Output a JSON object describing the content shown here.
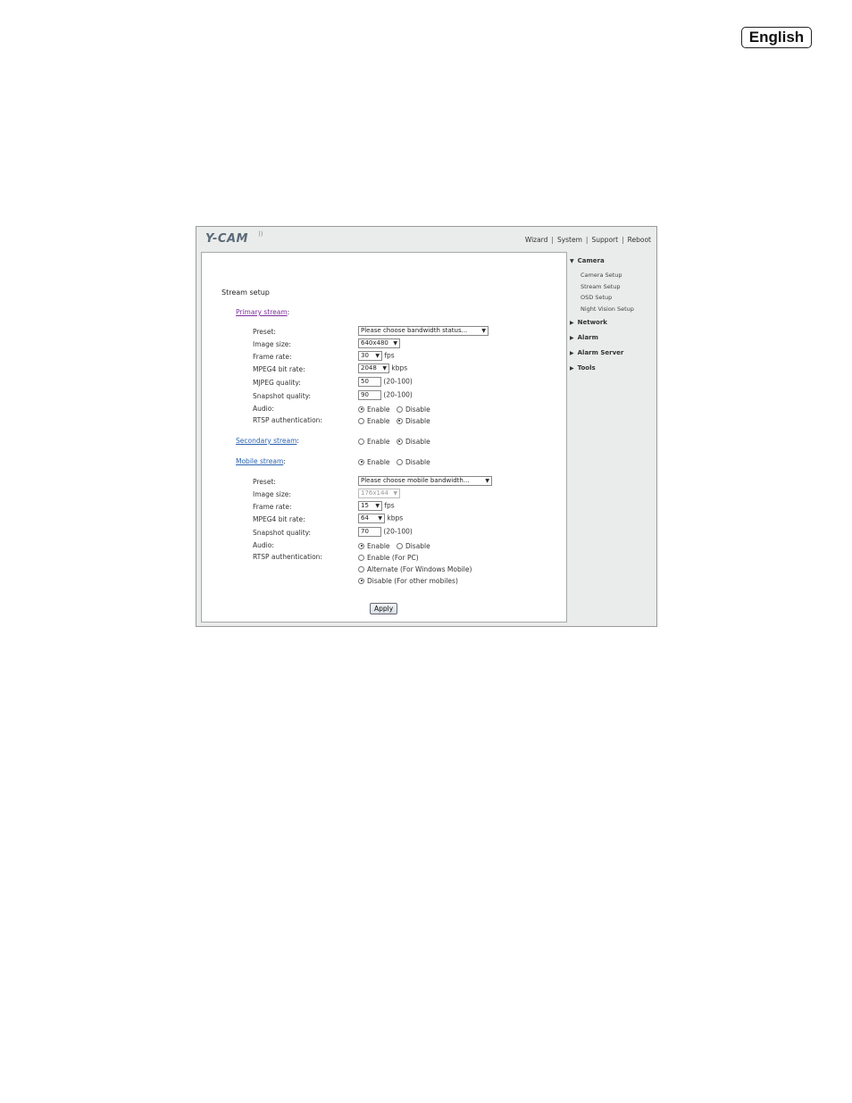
{
  "language_badge": "English",
  "header": {
    "logo": "Y-CAM",
    "logo_mark": "))",
    "links": [
      "Wizard",
      "System",
      "Support",
      "Reboot"
    ],
    "separator": "|"
  },
  "sidebar": {
    "sections": [
      {
        "label": "Camera",
        "expanded": true,
        "items": [
          "Camera Setup",
          "Stream Setup",
          "OSD Setup",
          "Night Vision Setup"
        ]
      },
      {
        "label": "Network",
        "expanded": false
      },
      {
        "label": "Alarm",
        "expanded": false
      },
      {
        "label": "Alarm Server",
        "expanded": false
      },
      {
        "label": "Tools",
        "expanded": false
      }
    ]
  },
  "form": {
    "title": "Stream setup",
    "colon": ":",
    "primary": {
      "link": "Primary stream",
      "link_color": "#7b2f9a",
      "preset_label": "Preset:",
      "preset_value": "Please choose bandwidth status...",
      "image_size_label": "Image size:",
      "image_size_value": "640x480",
      "frame_rate_label": "Frame rate:",
      "frame_rate_value": "30",
      "frame_rate_unit": "fps",
      "mpeg4_label": "MPEG4 bit rate:",
      "mpeg4_value": "2048",
      "mpeg4_unit": "kbps",
      "mjpeg_label": "MJPEG quality:",
      "mjpeg_value": "50",
      "mjpeg_range": "(20-100)",
      "snapshot_label": "Snapshot quality:",
      "snapshot_value": "90",
      "snapshot_range": "(20-100)",
      "audio_label": "Audio:",
      "audio_options": [
        "Enable",
        "Disable"
      ],
      "audio_selected": "Enable",
      "rtsp_label": "RTSP authentication:",
      "rtsp_options": [
        "Enable",
        "Disable"
      ],
      "rtsp_selected": "Disable"
    },
    "secondary": {
      "link": "Secondary stream",
      "link_color": "#2a63b0",
      "options": [
        "Enable",
        "Disable"
      ],
      "selected": "Disable"
    },
    "mobile": {
      "link": "Mobile stream",
      "link_color": "#2a63b0",
      "options": [
        "Enable",
        "Disable"
      ],
      "selected": "Enable",
      "preset_label": "Preset:",
      "preset_value": "Please choose mobile bandwidth...",
      "image_size_label": "Image size:",
      "image_size_value": "176x144",
      "frame_rate_label": "Frame rate:",
      "frame_rate_value": "15",
      "frame_rate_unit": "fps",
      "mpeg4_label": "MPEG4 bit rate:",
      "mpeg4_value": "64",
      "mpeg4_unit": "kbps",
      "snapshot_label": "Snapshot quality:",
      "snapshot_value": "70",
      "snapshot_range": "(20-100)",
      "audio_label": "Audio:",
      "audio_options": [
        "Enable",
        "Disable"
      ],
      "audio_selected": "Enable",
      "rtsp_label": "RTSP authentication:",
      "rtsp_options": [
        "Enable (For PC)",
        "Alternate (For Windows Mobile)",
        "Disable (For other mobiles)"
      ],
      "rtsp_selected": "Disable (For other mobiles)"
    },
    "apply_label": "Apply"
  }
}
